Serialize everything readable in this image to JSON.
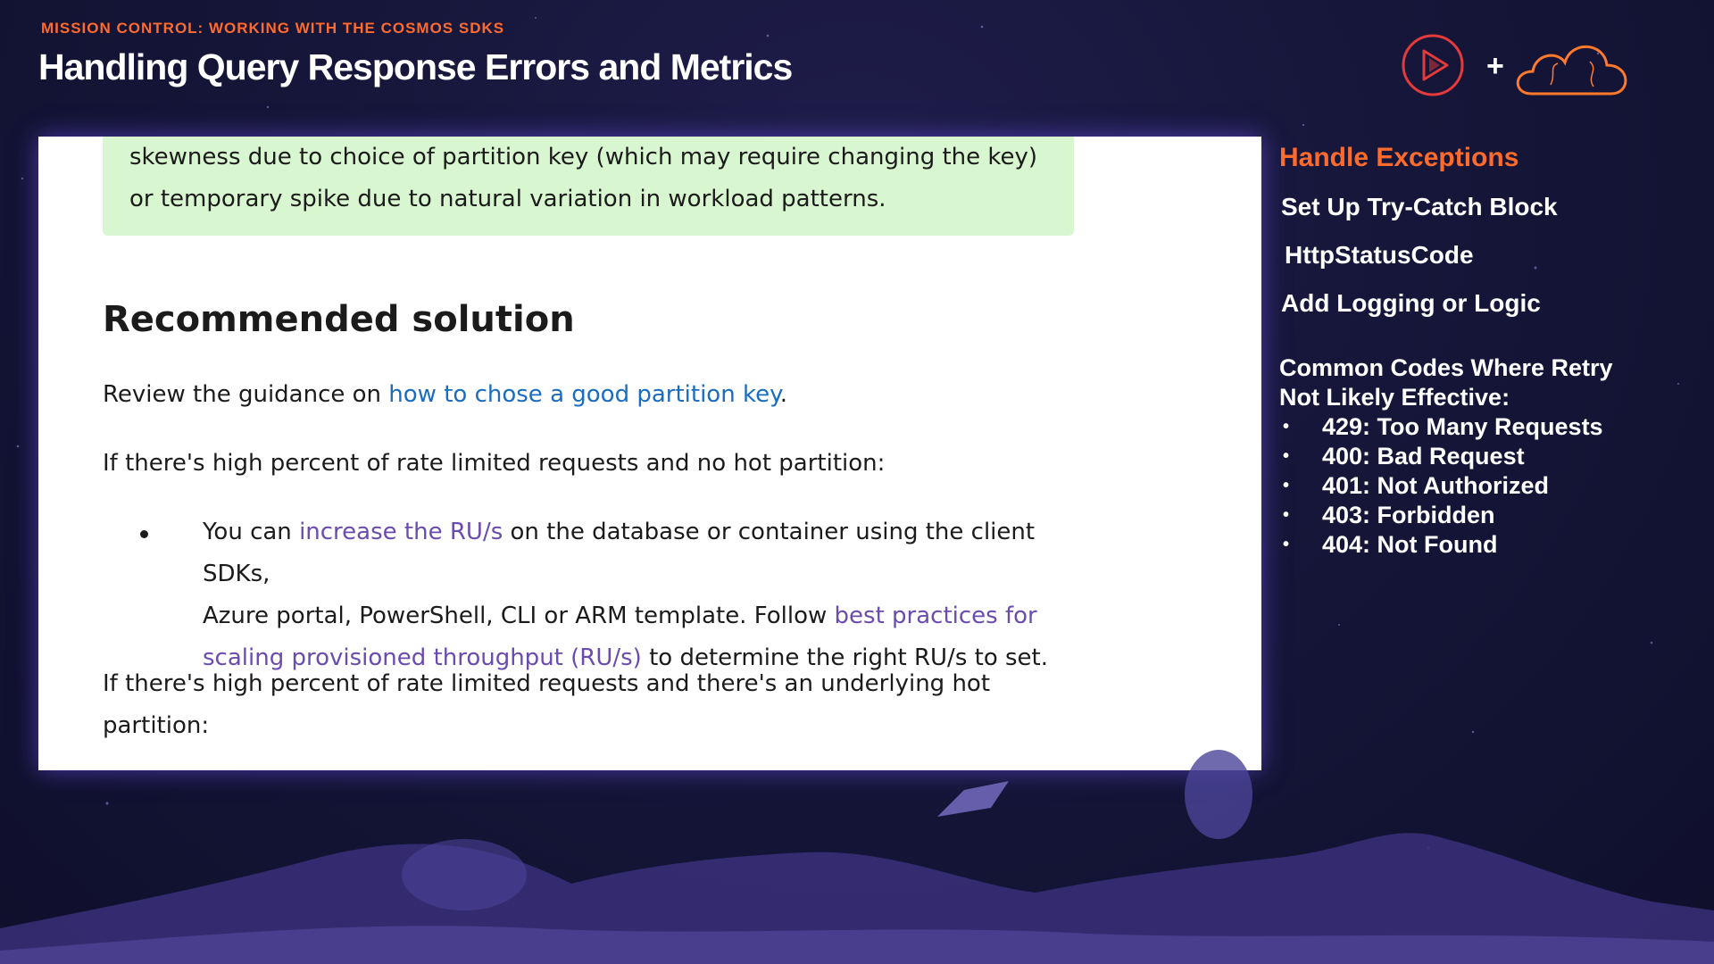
{
  "header": {
    "kicker": "MISSION CONTROL: WORKING WITH THE COSMOS SDKS",
    "title": "Handling Query Response Errors and Metrics"
  },
  "logos": {
    "plus": "+"
  },
  "doc": {
    "note_line1": "skewness due to choice of partition key (which may require changing the key)",
    "note_line2": "or temporary spike due to natural variation in workload patterns.",
    "heading": "Recommended solution",
    "p1_prefix": "Review the guidance on ",
    "p1_link": "how to chose a good partition key",
    "p1_suffix": ".",
    "p2": "If there's high percent of rate limited requests and no hot partition:",
    "bullet_a": "You can ",
    "bullet_link1": "increase the RU/s",
    "bullet_b": " on the database or container using the client SDKs,",
    "bullet_c": "Azure portal, PowerShell, CLI or ARM template. Follow ",
    "bullet_link2a": "best practices for",
    "bullet_link2b": "scaling provisioned throughput (RU/s)",
    "bullet_d": " to determine the right RU/s to set.",
    "p3_line1": "If there's high percent of rate limited requests and there's an underlying hot",
    "p3_line2": "partition:"
  },
  "sidebar": {
    "heading": "Handle Exceptions",
    "items": [
      "Set Up Try-Catch Block",
      "HttpStatusCode",
      "Add Logging or Logic"
    ],
    "codes_title_line1": "Common Codes Where Retry",
    "codes_title_line2": "Not Likely Effective:",
    "codes": [
      "429: Too Many Requests",
      "400: Bad Request",
      "401: Not Authorized",
      "403: Forbidden",
      "404: Not Found"
    ]
  },
  "colors": {
    "accent": "#ff6b2c",
    "link": "#1a6cc0",
    "note_bg": "#d8f6cf"
  },
  "icons": [
    "play-logo-icon",
    "cloud-logo-icon"
  ]
}
